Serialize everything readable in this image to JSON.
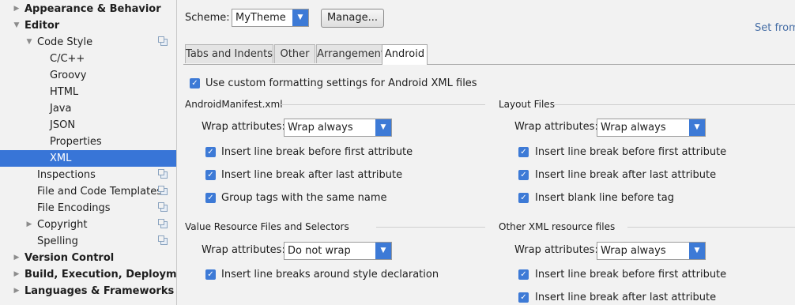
{
  "sidebar": {
    "items": [
      {
        "label": "Appearance & Behavior",
        "arrow": "▶"
      },
      {
        "label": "Editor",
        "arrow": "▼"
      },
      {
        "label": "Code Style",
        "arrow": "▼"
      },
      {
        "label": "C/C++"
      },
      {
        "label": "Groovy"
      },
      {
        "label": "HTML"
      },
      {
        "label": "Java"
      },
      {
        "label": "JSON"
      },
      {
        "label": "Properties"
      },
      {
        "label": "XML"
      },
      {
        "label": "Inspections"
      },
      {
        "label": "File and Code Templates"
      },
      {
        "label": "File Encodings"
      },
      {
        "label": "Copyright",
        "arrow": "▶"
      },
      {
        "label": "Spelling"
      },
      {
        "label": "Version Control",
        "arrow": "▶"
      },
      {
        "label": "Build, Execution, Deployment",
        "arrow": "▶"
      },
      {
        "label": "Languages & Frameworks",
        "arrow": "▶"
      }
    ]
  },
  "header": {
    "scheme_label": "Scheme:",
    "scheme_value": "MyTheme",
    "manage_label": "Manage...",
    "set_from_label": "Set from"
  },
  "tabs": [
    {
      "label": "Tabs and Indents"
    },
    {
      "label": "Other"
    },
    {
      "label": "Arrangement"
    },
    {
      "label": "Android"
    }
  ],
  "android": {
    "use_custom_label": "Use custom formatting settings for Android XML files",
    "manifest": {
      "title": "AndroidManifest.xml",
      "wrap_label": "Wrap attributes:",
      "wrap_value": "Wrap always",
      "checks": [
        "Insert line break before first attribute",
        "Insert line break after last attribute",
        "Group tags with the same name"
      ]
    },
    "layout": {
      "title": "Layout Files",
      "wrap_label": "Wrap attributes:",
      "wrap_value": "Wrap always",
      "checks": [
        "Insert line break before first attribute",
        "Insert line break after last attribute",
        "Insert blank line before tag"
      ]
    },
    "values": {
      "title": "Value Resource Files and Selectors",
      "wrap_label": "Wrap attributes:",
      "wrap_value": "Do not wrap",
      "checks": [
        "Insert line breaks around style declaration"
      ]
    },
    "other": {
      "title": "Other XML resource files",
      "wrap_label": "Wrap attributes:",
      "wrap_value": "Wrap always",
      "checks": [
        "Insert line break before first attribute",
        "Insert line break after last attribute"
      ]
    }
  },
  "colors": {
    "selection": "#3875d7",
    "accent": "#3d7ad6"
  }
}
